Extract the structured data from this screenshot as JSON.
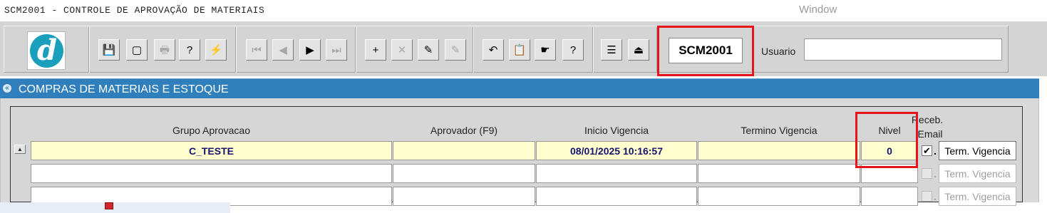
{
  "window": {
    "app_title": "SCM2001 - CONTROLE DE APROVAÇÃO DE MATERIAIS",
    "menu_window": "Window"
  },
  "toolbar": {
    "logo_letter": "d",
    "buttons": [
      {
        "name": "save-button",
        "glyph": "💾",
        "enabled": false
      },
      {
        "name": "enter-query-button",
        "glyph": "▢",
        "enabled": true
      },
      {
        "name": "print-button",
        "glyph": "🖶",
        "enabled": false
      },
      {
        "name": "execute-query-button",
        "glyph": "?",
        "enabled": true
      },
      {
        "name": "count-query-button",
        "glyph": "⚡",
        "enabled": true
      },
      {
        "name": "first-record-button",
        "glyph": "⏮",
        "enabled": false
      },
      {
        "name": "previous-record-button",
        "glyph": "◀",
        "enabled": false
      },
      {
        "name": "next-record-button",
        "glyph": "▶",
        "enabled": true
      },
      {
        "name": "last-record-button",
        "glyph": "⏭",
        "enabled": false
      },
      {
        "name": "insert-record-button",
        "glyph": "+",
        "enabled": true
      },
      {
        "name": "delete-record-button",
        "glyph": "✕",
        "enabled": false
      },
      {
        "name": "lock-record-button",
        "glyph": "✎",
        "enabled": true
      },
      {
        "name": "duplicate-record-button",
        "glyph": "✎",
        "enabled": false
      },
      {
        "name": "undo-button",
        "glyph": "↶",
        "enabled": true
      },
      {
        "name": "list-button",
        "glyph": "📋",
        "enabled": true
      },
      {
        "name": "edit-button",
        "glyph": "☛",
        "enabled": true
      },
      {
        "name": "help-button",
        "glyph": "?",
        "enabled": true
      },
      {
        "name": "menu-button",
        "glyph": "☰",
        "enabled": true
      },
      {
        "name": "exit-button",
        "glyph": "⏏",
        "enabled": true
      }
    ],
    "form_code": "SCM2001",
    "user_label": "Usuario",
    "user_value": ""
  },
  "section": {
    "title": "COMPRAS DE MATERIAIS E ESTOQUE",
    "collapse_glyph": "«"
  },
  "grid": {
    "headers": {
      "grupo": "Grupo Aprovacao",
      "aprovador": "Aprovador (F9)",
      "inicio": "Inicio Vigencia",
      "termino": "Termino Vigencia",
      "nivel": "Nivel",
      "receb": "Receb.",
      "email": "Email"
    },
    "term_button_label": "Term. Vigencia",
    "rows": [
      {
        "grupo": "C_TESTE",
        "aprovador": "",
        "inicio": "08/01/2025 10:16:57",
        "termino": "",
        "nivel": "0",
        "receb_email": true,
        "check_mark": "✔",
        "dot": "."
      },
      {
        "grupo": "",
        "aprovador": "",
        "inicio": "",
        "termino": "",
        "nivel": "",
        "receb_email": false,
        "check_mark": "",
        "dot": "."
      },
      {
        "grupo": "",
        "aprovador": "",
        "inicio": "",
        "termino": "",
        "nivel": "",
        "receb_email": false,
        "check_mark": "",
        "dot": "."
      }
    ]
  },
  "colors": {
    "header_blue": "#2f7fbc",
    "highlight_red": "#e8141c",
    "current_row_yellow": "#fefecf"
  }
}
